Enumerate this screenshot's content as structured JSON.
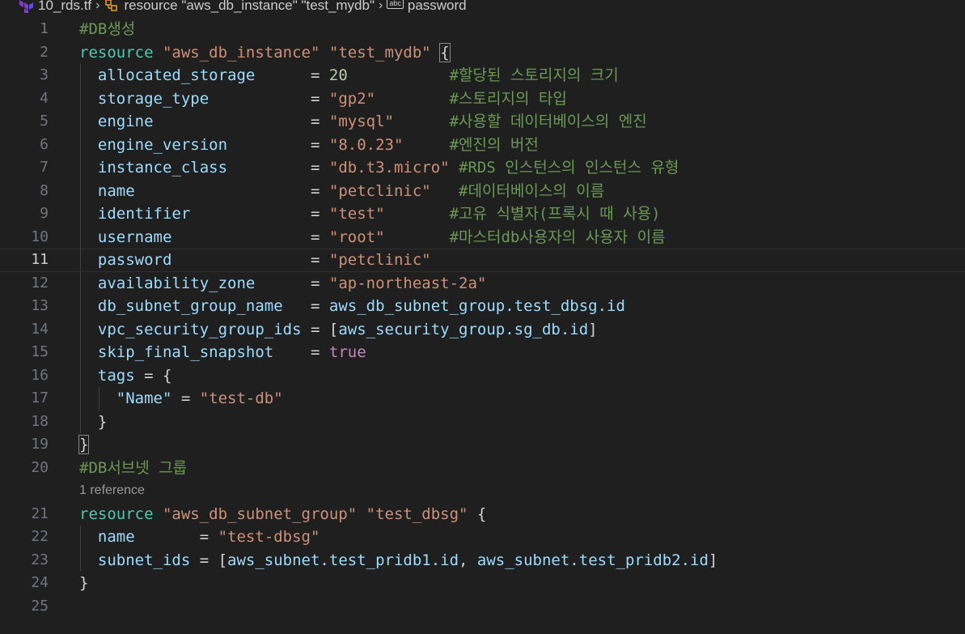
{
  "breadcrumb": {
    "file": "10_rds.tf",
    "resource": "resource \"aws_db_instance\" \"test_mydb\"",
    "symbol": "password",
    "symbol_icon": "abc"
  },
  "editor": {
    "current_line": 11,
    "codelens": "1 reference",
    "lines": [
      {
        "n": "1",
        "tokens": [
          {
            "t": "#DB생성",
            "c": "cmt"
          }
        ]
      },
      {
        "n": "2",
        "tokens": [
          {
            "t": "resource",
            "c": "kwr"
          },
          {
            "t": " ",
            "c": "punc"
          },
          {
            "t": "\"aws_db_instance\"",
            "c": "str"
          },
          {
            "t": " ",
            "c": "punc"
          },
          {
            "t": "\"test_mydb\"",
            "c": "str"
          },
          {
            "t": " ",
            "c": "punc"
          },
          {
            "t": "{",
            "c": "punc brace-hl"
          }
        ]
      },
      {
        "n": "3",
        "tokens": [
          {
            "t": "  allocated_storage      ",
            "c": "attr"
          },
          {
            "t": "= ",
            "c": "punc"
          },
          {
            "t": "20",
            "c": "num"
          },
          {
            "t": "           ",
            "c": "punc"
          },
          {
            "t": "#할당된 스토리지의 크기",
            "c": "cmt"
          }
        ]
      },
      {
        "n": "4",
        "tokens": [
          {
            "t": "  storage_type           ",
            "c": "attr"
          },
          {
            "t": "= ",
            "c": "punc"
          },
          {
            "t": "\"gp2\"",
            "c": "str"
          },
          {
            "t": "        ",
            "c": "punc"
          },
          {
            "t": "#스토리지의 타입",
            "c": "cmt"
          }
        ]
      },
      {
        "n": "5",
        "tokens": [
          {
            "t": "  engine                 ",
            "c": "attr"
          },
          {
            "t": "= ",
            "c": "punc"
          },
          {
            "t": "\"mysql\"",
            "c": "str"
          },
          {
            "t": "      ",
            "c": "punc"
          },
          {
            "t": "#사용할 데이터베이스의 엔진",
            "c": "cmt"
          }
        ]
      },
      {
        "n": "6",
        "tokens": [
          {
            "t": "  engine_version         ",
            "c": "attr"
          },
          {
            "t": "= ",
            "c": "punc"
          },
          {
            "t": "\"8.0.23\"",
            "c": "str"
          },
          {
            "t": "     ",
            "c": "punc"
          },
          {
            "t": "#엔진의 버전",
            "c": "cmt"
          }
        ]
      },
      {
        "n": "7",
        "tokens": [
          {
            "t": "  instance_class         ",
            "c": "attr"
          },
          {
            "t": "= ",
            "c": "punc"
          },
          {
            "t": "\"db.t3.micro\"",
            "c": "str"
          },
          {
            "t": " ",
            "c": "punc"
          },
          {
            "t": "#RDS 인스턴스의 인스턴스 유형",
            "c": "cmt"
          }
        ]
      },
      {
        "n": "8",
        "tokens": [
          {
            "t": "  name                   ",
            "c": "attr"
          },
          {
            "t": "= ",
            "c": "punc"
          },
          {
            "t": "\"petclinic\"",
            "c": "str"
          },
          {
            "t": "   ",
            "c": "punc"
          },
          {
            "t": "#데이터베이스의 이름",
            "c": "cmt"
          }
        ]
      },
      {
        "n": "9",
        "tokens": [
          {
            "t": "  identifier             ",
            "c": "attr"
          },
          {
            "t": "= ",
            "c": "punc"
          },
          {
            "t": "\"test\"",
            "c": "str"
          },
          {
            "t": "       ",
            "c": "punc"
          },
          {
            "t": "#고유 식별자(프록시 때 사용)",
            "c": "cmt"
          }
        ]
      },
      {
        "n": "10",
        "tokens": [
          {
            "t": "  username               ",
            "c": "attr"
          },
          {
            "t": "= ",
            "c": "punc"
          },
          {
            "t": "\"root\"",
            "c": "str"
          },
          {
            "t": "       ",
            "c": "punc"
          },
          {
            "t": "#마스터db사용자의 사용자 이름",
            "c": "cmt"
          }
        ]
      },
      {
        "n": "11",
        "tokens": [
          {
            "t": "  password               ",
            "c": "attr"
          },
          {
            "t": "= ",
            "c": "punc"
          },
          {
            "t": "\"petclinic\"",
            "c": "str"
          }
        ]
      },
      {
        "n": "12",
        "tokens": [
          {
            "t": "  availability_zone      ",
            "c": "attr"
          },
          {
            "t": "= ",
            "c": "punc"
          },
          {
            "t": "\"ap-northeast-2a\"",
            "c": "str"
          }
        ]
      },
      {
        "n": "13",
        "tokens": [
          {
            "t": "  db_subnet_group_name   ",
            "c": "attr"
          },
          {
            "t": "= ",
            "c": "punc"
          },
          {
            "t": "aws_db_subnet_group.test_dbsg.id",
            "c": "attr"
          }
        ]
      },
      {
        "n": "14",
        "tokens": [
          {
            "t": "  vpc_security_group_ids ",
            "c": "attr"
          },
          {
            "t": "= [",
            "c": "punc"
          },
          {
            "t": "aws_security_group.sg_db.id",
            "c": "attr"
          },
          {
            "t": "]",
            "c": "punc"
          }
        ]
      },
      {
        "n": "15",
        "tokens": [
          {
            "t": "  skip_final_snapshot    ",
            "c": "attr"
          },
          {
            "t": "= ",
            "c": "punc"
          },
          {
            "t": "true",
            "c": "bool"
          }
        ]
      },
      {
        "n": "16",
        "tokens": [
          {
            "t": "  tags",
            "c": "attr"
          },
          {
            "t": " = {",
            "c": "punc"
          }
        ]
      },
      {
        "n": "17",
        "tokens": [
          {
            "t": "    ",
            "c": "punc"
          },
          {
            "t": "\"Name\"",
            "c": "attr"
          },
          {
            "t": " = ",
            "c": "punc"
          },
          {
            "t": "\"test-db\"",
            "c": "str"
          }
        ]
      },
      {
        "n": "18",
        "tokens": [
          {
            "t": "  }",
            "c": "punc"
          }
        ]
      },
      {
        "n": "19",
        "tokens": [
          {
            "t": "}",
            "c": "punc brace-hl"
          }
        ]
      },
      {
        "n": "20",
        "tokens": [
          {
            "t": "#DB서브넷 그룹",
            "c": "cmt"
          }
        ]
      },
      {
        "n": "21",
        "tokens": [
          {
            "t": "resource",
            "c": "kwr"
          },
          {
            "t": " ",
            "c": "punc"
          },
          {
            "t": "\"aws_db_subnet_group\"",
            "c": "str"
          },
          {
            "t": " ",
            "c": "punc"
          },
          {
            "t": "\"test_dbsg\"",
            "c": "str"
          },
          {
            "t": " {",
            "c": "punc"
          }
        ]
      },
      {
        "n": "22",
        "tokens": [
          {
            "t": "  name       ",
            "c": "attr"
          },
          {
            "t": "= ",
            "c": "punc"
          },
          {
            "t": "\"test-dbsg\"",
            "c": "str"
          }
        ]
      },
      {
        "n": "23",
        "tokens": [
          {
            "t": "  subnet_ids ",
            "c": "attr"
          },
          {
            "t": "= [",
            "c": "punc"
          },
          {
            "t": "aws_subnet.test_pridb1.id",
            "c": "attr"
          },
          {
            "t": ", ",
            "c": "punc"
          },
          {
            "t": "aws_subnet.test_pridb2.id",
            "c": "attr"
          },
          {
            "t": "]",
            "c": "punc"
          }
        ]
      },
      {
        "n": "24",
        "tokens": [
          {
            "t": "}",
            "c": "punc"
          }
        ]
      },
      {
        "n": "25",
        "tokens": []
      }
    ]
  },
  "colors": {
    "background": "#1f1f1f",
    "string": "#ce9178",
    "keyword": "#4ec9b0",
    "attribute": "#9cdcfe",
    "comment": "#6a9955",
    "number": "#b5cea8",
    "boolean": "#c586c0"
  }
}
